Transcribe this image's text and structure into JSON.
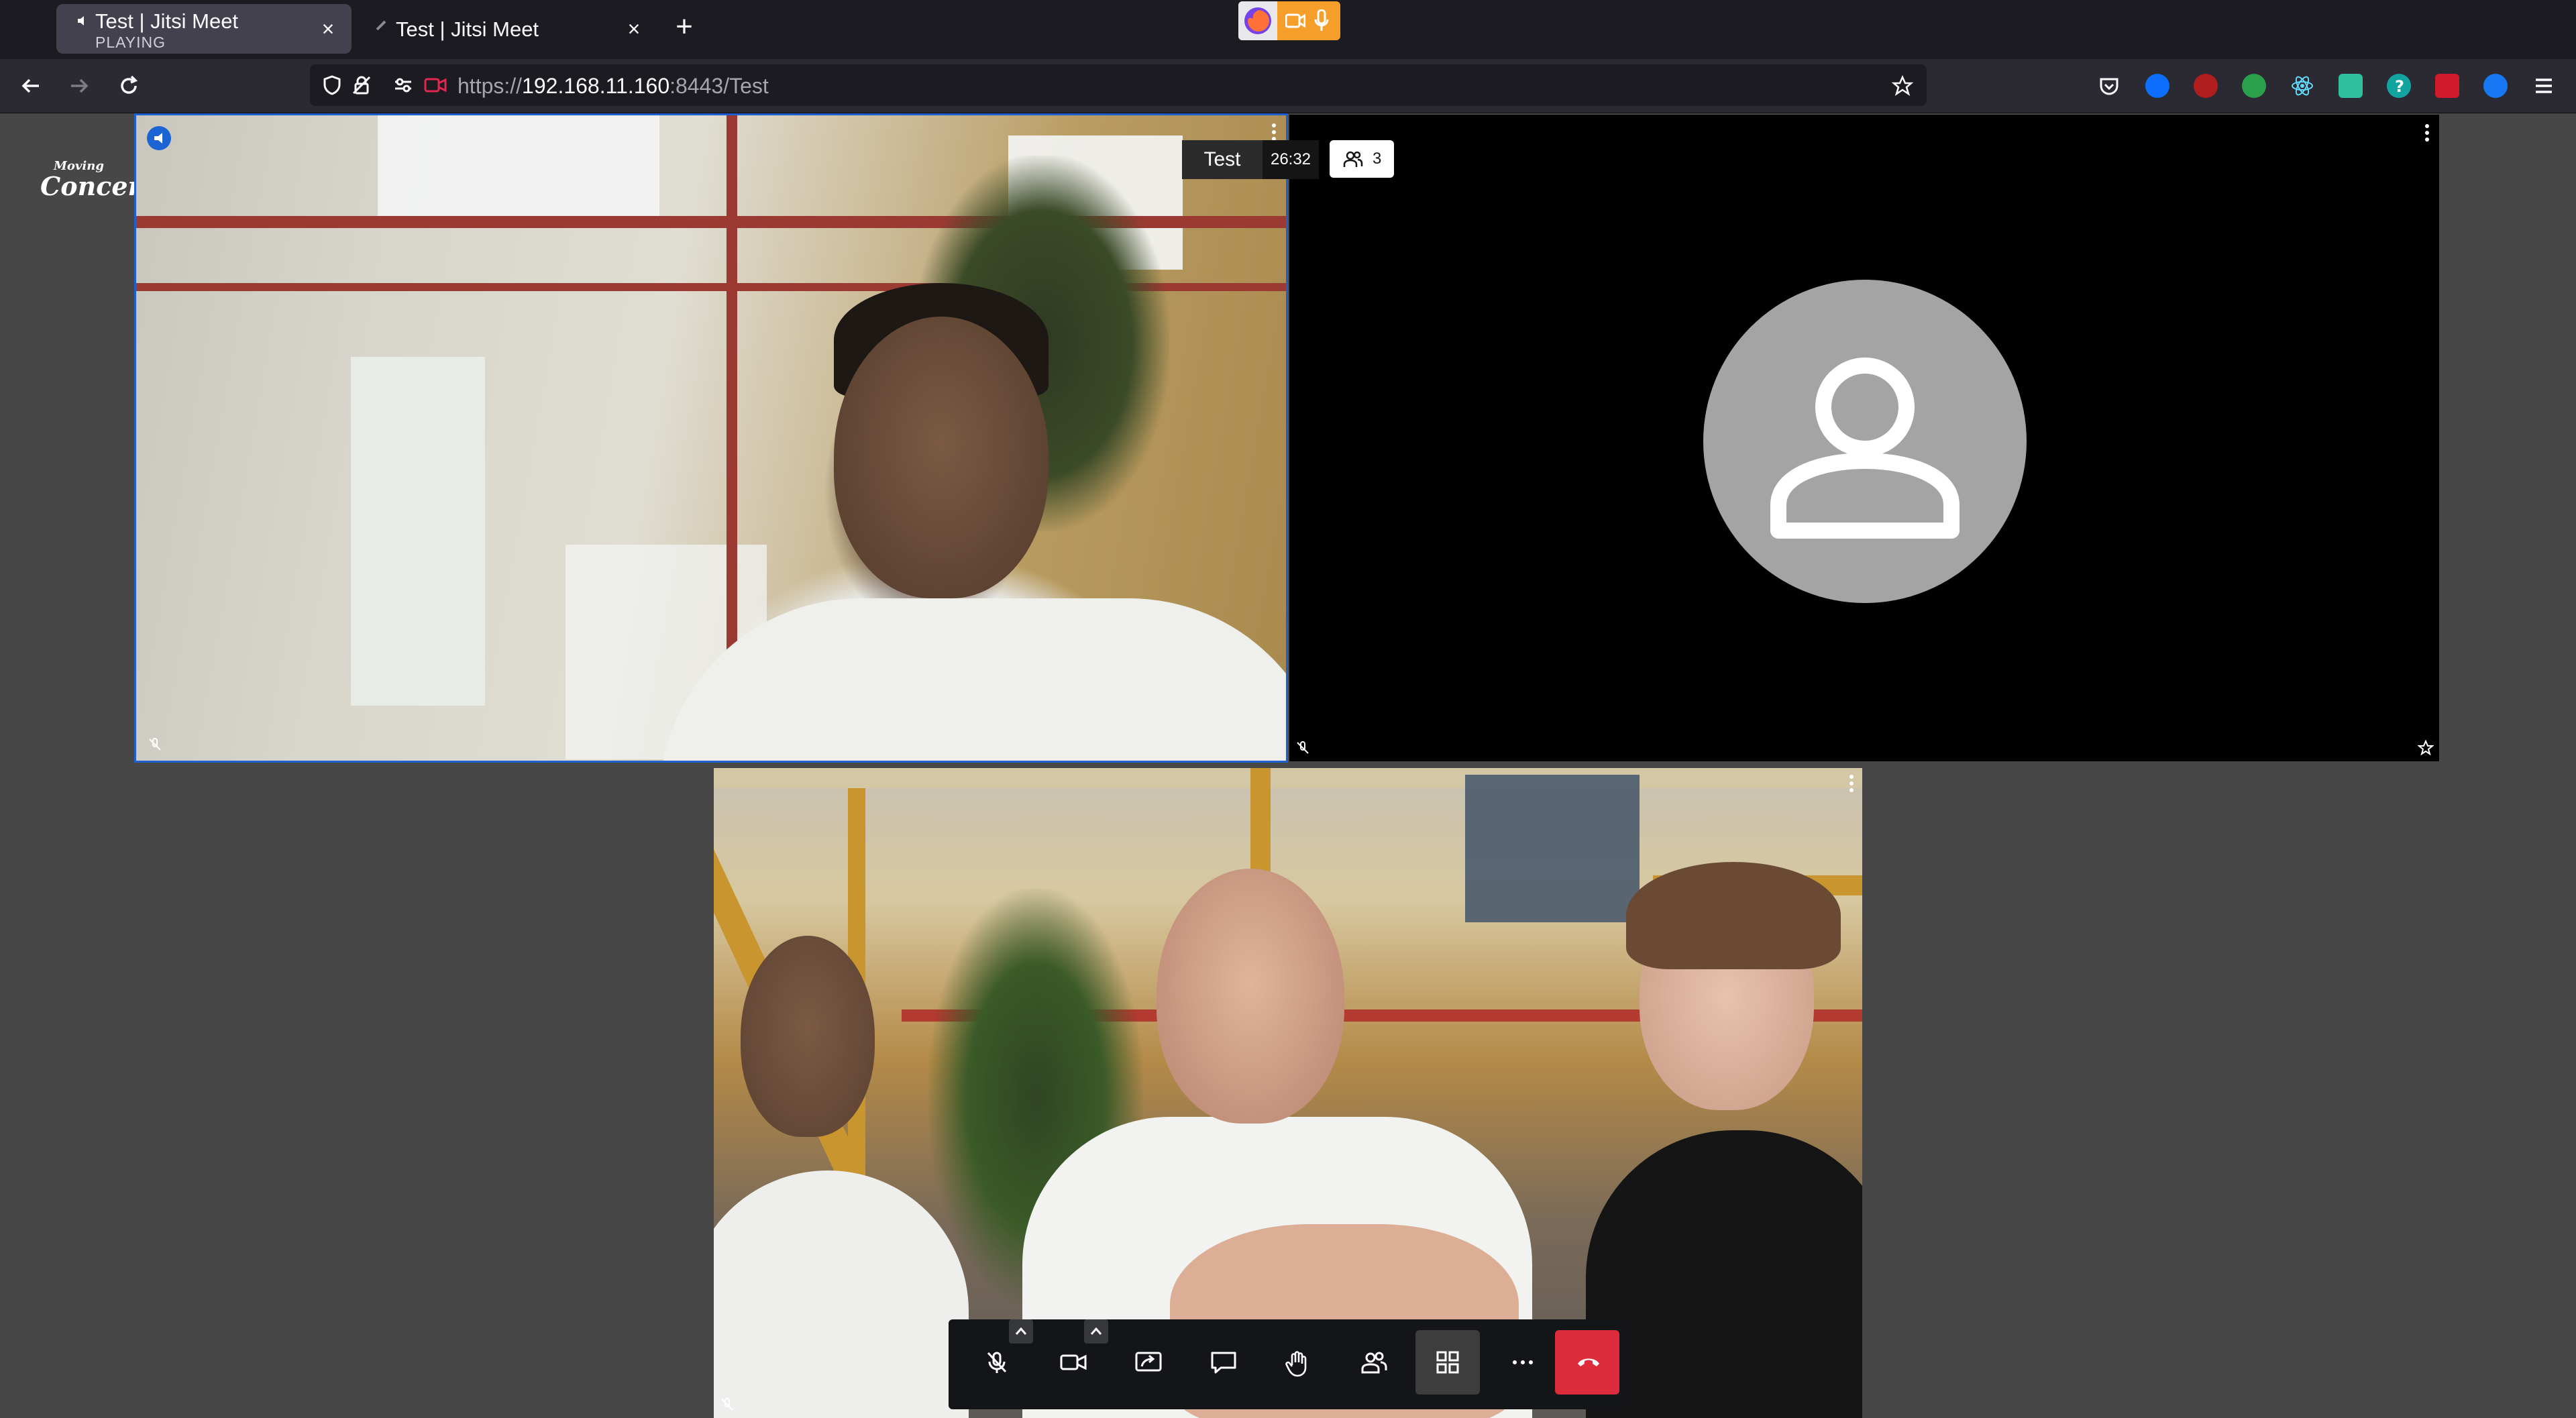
{
  "browser": {
    "tabs": [
      {
        "title": "Test | Jitsi Meet",
        "subtitle": "PLAYING",
        "active": true
      },
      {
        "title": "Test | Jitsi Meet",
        "subtitle": "",
        "active": false
      }
    ],
    "url": {
      "scheme": "https://",
      "host": "192.168.11.160",
      "rest": ":8443/Test"
    },
    "icons": [
      "back-icon",
      "forward-icon",
      "reload-icon",
      "shield-icon",
      "lock-icon",
      "permissions-icon",
      "camera-sharing-icon",
      "bookmark-star-icon",
      "pocket-icon",
      "menu-icon"
    ]
  },
  "meeting": {
    "logo": {
      "line1": "Moving",
      "line2": "Concert"
    },
    "room_name": "Test",
    "timer": "26:32",
    "participant_count": "3"
  },
  "colors": {
    "stage": "#474747",
    "active_border": "#1f5fcf",
    "hangup": "#dd2d3d",
    "toolbar": "#131519",
    "accent_indicator": "#f59f2a"
  },
  "toolbar": {
    "buttons": [
      "mic-muted-icon",
      "camera-icon",
      "screenshare-icon",
      "chat-icon",
      "raise-hand-icon",
      "participants-icon",
      "tile-view-icon",
      "more-icon",
      "hangup-icon"
    ]
  }
}
